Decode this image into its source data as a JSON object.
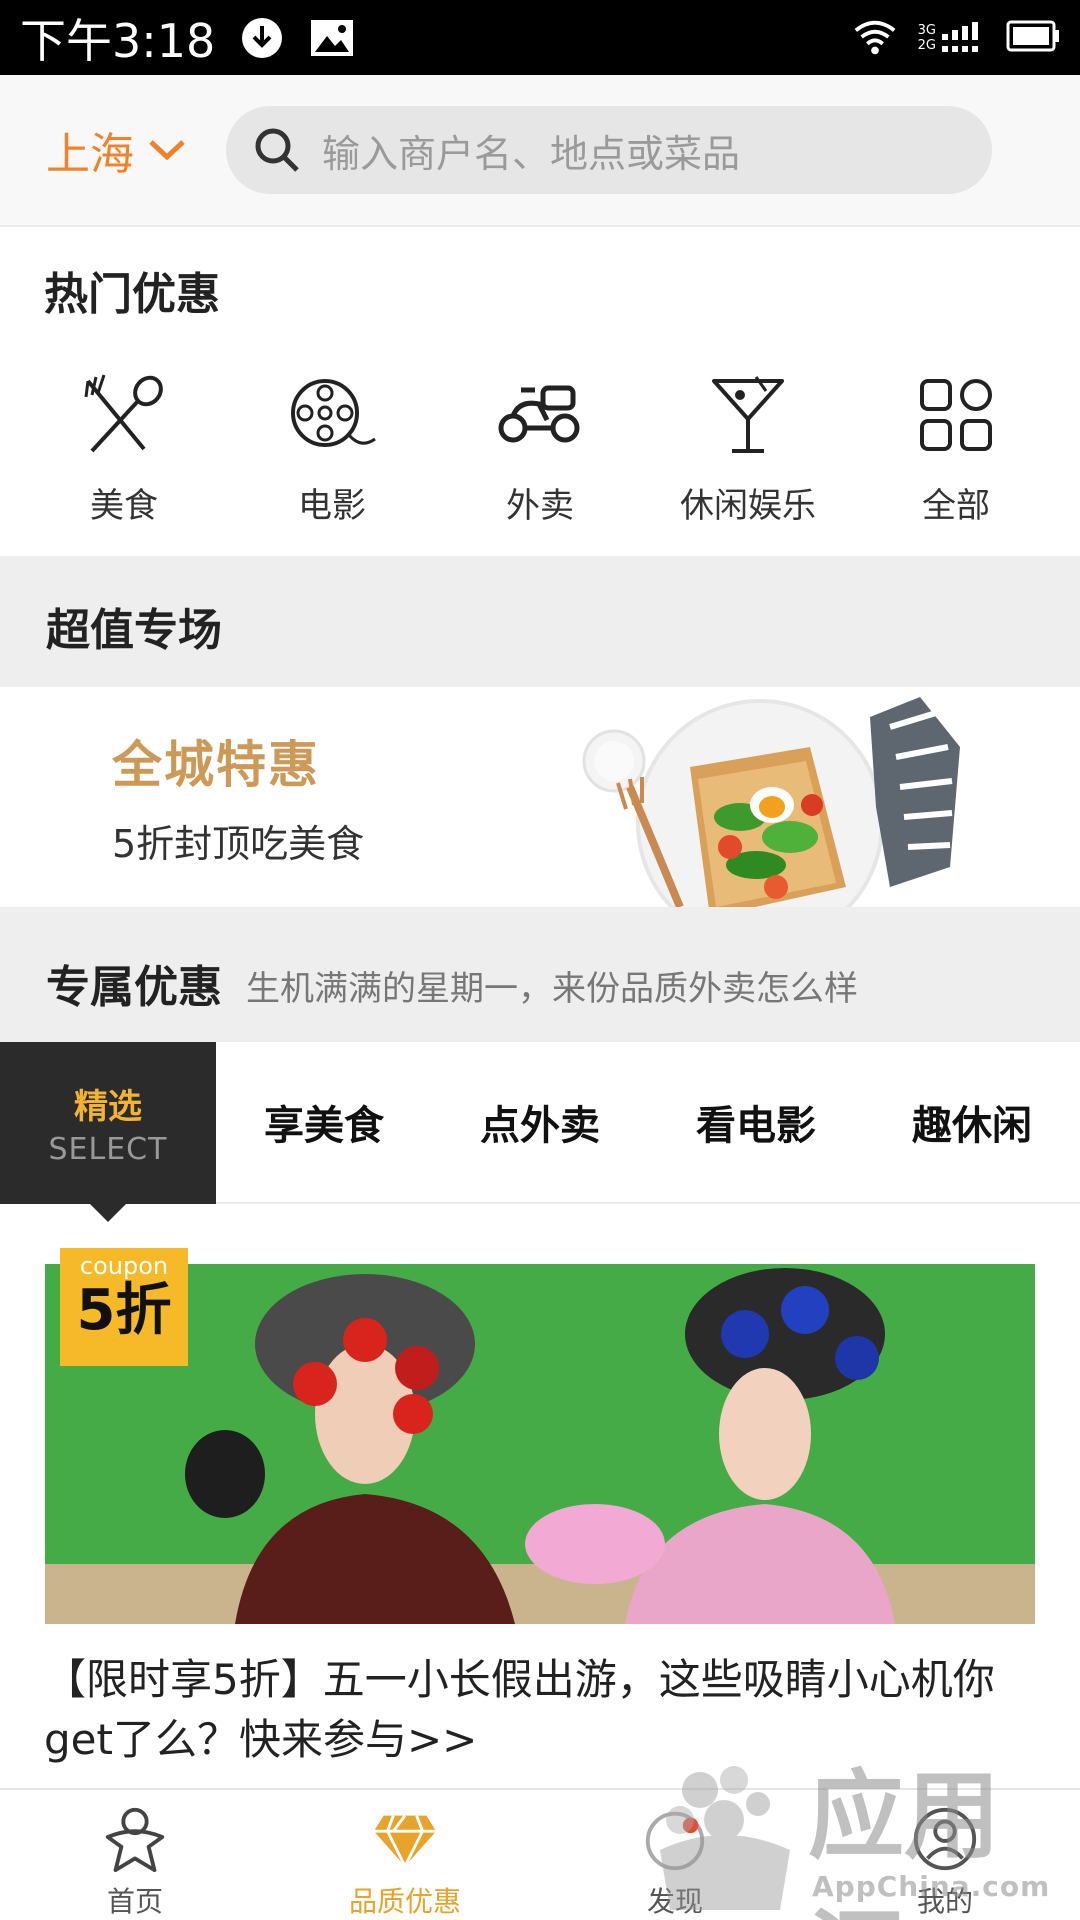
{
  "status_bar": {
    "time": "下午3:18",
    "net_3g": "3G",
    "net_2g": "2G"
  },
  "header": {
    "city": "上海",
    "search_placeholder": "输入商户名、地点或菜品"
  },
  "hot_deals": {
    "title": "热门优惠",
    "categories": [
      {
        "label": "美食",
        "icon": "fork-spoon-icon"
      },
      {
        "label": "电影",
        "icon": "film-reel-icon"
      },
      {
        "label": "外卖",
        "icon": "scooter-icon"
      },
      {
        "label": "休闲娱乐",
        "icon": "cocktail-icon"
      },
      {
        "label": "全部",
        "icon": "grid-icon"
      }
    ]
  },
  "super_value": {
    "title": "超值专场",
    "promo_title": "全城特惠",
    "promo_subtitle": "5折封顶吃美食"
  },
  "exclusive": {
    "title": "专属优惠",
    "subtitle": "生机满满的星期一，来份品质外卖怎么样"
  },
  "tabs": {
    "selected_cn": "精选",
    "selected_en": "SELECT",
    "items": [
      "享美食",
      "点外卖",
      "看电影",
      "趣休闲"
    ]
  },
  "feature": {
    "coupon_label": "coupon",
    "coupon_value": "5折",
    "title": "【限时享5折】五一小长假出游，这些吸睛小心机你get了么？快来参与>>"
  },
  "bottom_nav": {
    "items": [
      {
        "label": "首页",
        "icon": "home-figure-icon"
      },
      {
        "label": "品质优惠",
        "icon": "diamond-icon"
      },
      {
        "label": "发现",
        "icon": "discover-icon"
      },
      {
        "label": "我的",
        "icon": "user-icon"
      }
    ],
    "active_index": 1
  },
  "watermark": {
    "text": "应用汇",
    "sub": "AppChina.com"
  },
  "colors": {
    "accent": "#f0832a",
    "gold": "#cc9a56",
    "coupon": "#f6b927",
    "dark_tab": "#2b2b2b"
  }
}
